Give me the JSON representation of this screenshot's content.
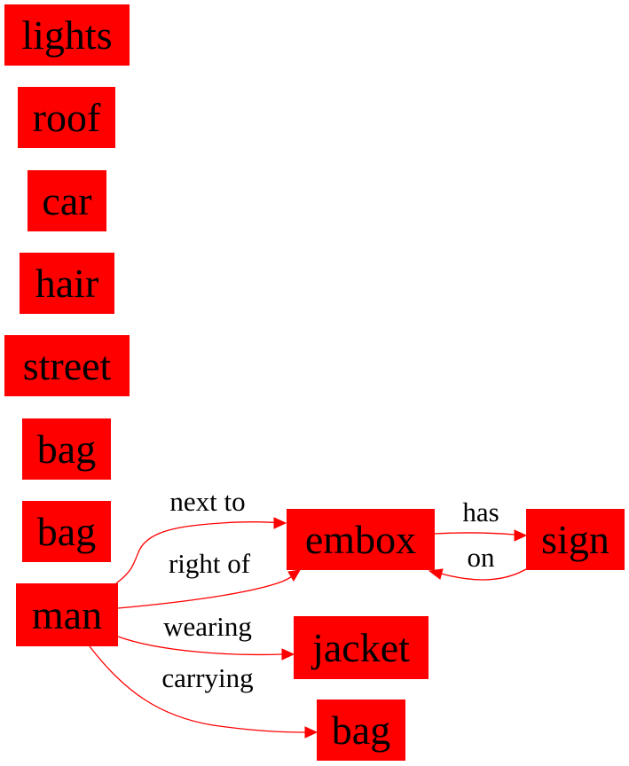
{
  "colors": {
    "node_fill": "#ff0000",
    "edge": "#ff0000",
    "text": "#000000"
  },
  "nodes": [
    {
      "id": "lights",
      "label": "lights"
    },
    {
      "id": "roof",
      "label": "roof"
    },
    {
      "id": "car",
      "label": "car"
    },
    {
      "id": "hair",
      "label": "hair"
    },
    {
      "id": "street",
      "label": "street"
    },
    {
      "id": "bag1",
      "label": "bag"
    },
    {
      "id": "bag2",
      "label": "bag"
    },
    {
      "id": "man",
      "label": "man"
    },
    {
      "id": "embox",
      "label": "embox"
    },
    {
      "id": "sign",
      "label": "sign"
    },
    {
      "id": "jacket",
      "label": "jacket"
    },
    {
      "id": "bag3",
      "label": "bag"
    }
  ],
  "edges": [
    {
      "id": "e1",
      "from": "man",
      "to": "embox",
      "label": "next to"
    },
    {
      "id": "e2",
      "from": "man",
      "to": "embox",
      "label": "right of"
    },
    {
      "id": "e3",
      "from": "man",
      "to": "jacket",
      "label": "wearing"
    },
    {
      "id": "e4",
      "from": "man",
      "to": "bag3",
      "label": "carrying"
    },
    {
      "id": "e5",
      "from": "embox",
      "to": "sign",
      "label": "has"
    },
    {
      "id": "e6",
      "from": "sign",
      "to": "embox",
      "label": "on"
    }
  ]
}
